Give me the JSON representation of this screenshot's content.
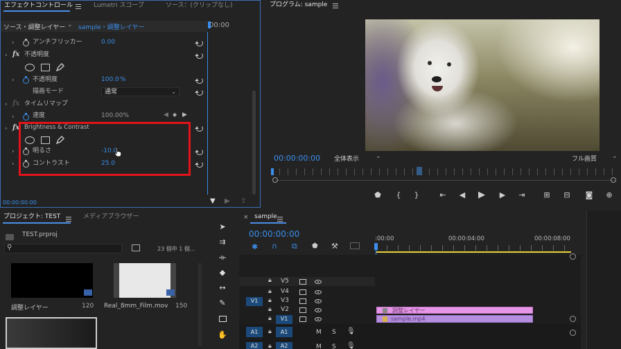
{
  "effect_controls": {
    "tabs": [
      "エフェクトコントロール",
      "Lumetri スコープ",
      "ソース：(クリップなし)"
    ],
    "source_label": "ソース・調整レイヤー",
    "sequence_label": "sample・調整レイヤー",
    "timecode_header": "00:00",
    "timecode_footer": "00:00:00:00",
    "rows": {
      "antiflicker_label": "アンチフリッカー",
      "antiflicker_value": "0.00",
      "opacity_label": "不透明度",
      "opacity_param_label": "不透明度",
      "opacity_value": "100.0",
      "opacity_unit": "%",
      "blend_label": "描画モード",
      "blend_value": "通常",
      "time_remap_label": "タイムリマップ",
      "speed_label": "速度",
      "speed_value": "100.00%",
      "bc_label": "Brightness & Contrast",
      "brightness_label": "明るさ",
      "brightness_value": "-10.0",
      "contrast_label": "コントラスト",
      "contrast_value": "25.0"
    },
    "fx_symbol": "fx"
  },
  "program": {
    "title": "プログラム: sample",
    "timecode": "00:00:00:00",
    "zoom": "全体表示",
    "quality": "フル画質"
  },
  "project": {
    "tabs": [
      "プロジェクト: TEST",
      "メディアブラウザー"
    ],
    "file": "TEST.prproj",
    "count": "23 個中 1 個...",
    "items": [
      {
        "name": "調整レイヤー",
        "meta": "120"
      },
      {
        "name": "Real_8mm_Film.mov",
        "meta": "150"
      }
    ]
  },
  "timeline": {
    "tab": "sample",
    "close": "×",
    "timecode": "00:00:00:00",
    "ruler": [
      ":00:00",
      "00:00:04:00",
      "00:00:08:00"
    ],
    "video_tracks": [
      "V5",
      "V4",
      "V3",
      "V2",
      "V1"
    ],
    "audio_tracks": [
      "A1",
      "A2"
    ],
    "source_v": "V1",
    "source_a": [
      "A1",
      "A2"
    ],
    "mute": "M",
    "solo": "S",
    "clips": {
      "adjustment": "調整レイヤー",
      "sample": "sample.mp4"
    }
  },
  "colors": {
    "accent": "#3b8eea",
    "highlight_box": "#e2141a",
    "adjustment_clip": "#e596e6",
    "video_clip": "#b58ee0",
    "in_out_bar": "#e8d238"
  }
}
